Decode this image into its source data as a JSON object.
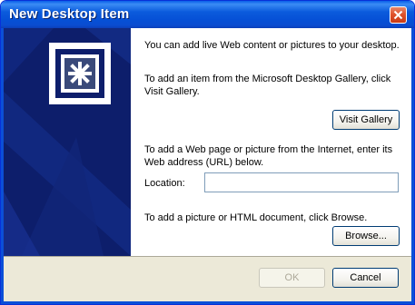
{
  "window": {
    "title": "New Desktop Item"
  },
  "dialog": {
    "intro": "You can add live Web content or pictures to your desktop.",
    "gallery_text": "To add an item from the Microsoft Desktop Gallery, click Visit Gallery.",
    "gallery_button": "Visit Gallery",
    "web_text": "To add a Web page or picture from the Internet, enter its Web address (URL) below.",
    "location_label": "Location:",
    "location_value": "",
    "browse_text": "To add a picture or HTML document, click Browse.",
    "browse_button": "Browse...",
    "ok_button": "OK",
    "cancel_button": "Cancel"
  },
  "icons": {
    "close": "close-icon",
    "desktop_item": "desktop-item-icon"
  }
}
